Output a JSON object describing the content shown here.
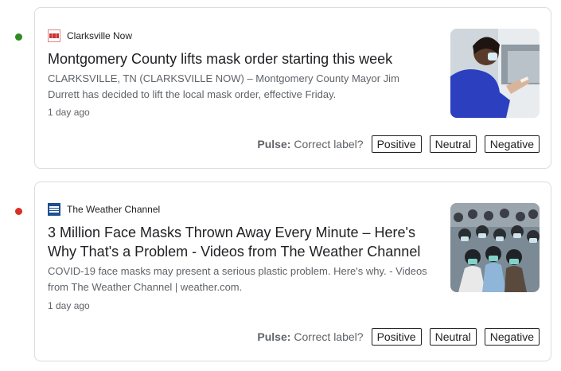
{
  "articles": [
    {
      "status_color": "#2e8b1f",
      "source": "Clarksville Now",
      "favicon": "clarksville-now-favicon",
      "headline": "Montgomery County lifts mask order starting this week",
      "snippet": "CLARKSVILLE, TN (CLARKSVILLE NOW) – Montgomery County Mayor Jim Durrett has decided to lift the local mask order, effective Friday.",
      "time": "1 day ago",
      "pulse": {
        "title": "Pulse:",
        "question": "Correct label?",
        "options": [
          "Positive",
          "Neutral",
          "Negative"
        ]
      }
    },
    {
      "status_color": "#d93025",
      "source": "The Weather Channel",
      "favicon": "weather-channel-favicon",
      "headline": "3 Million Face Masks Thrown Away Every Minute – Here's Why That's a Problem - Videos from The Weather Channel",
      "snippet": "COVID-19 face masks may present a serious plastic problem. Here's why. - Videos from The Weather Channel | weather.com.",
      "time": "1 day ago",
      "pulse": {
        "title": "Pulse:",
        "question": "Correct label?",
        "options": [
          "Positive",
          "Neutral",
          "Negative"
        ]
      }
    }
  ]
}
